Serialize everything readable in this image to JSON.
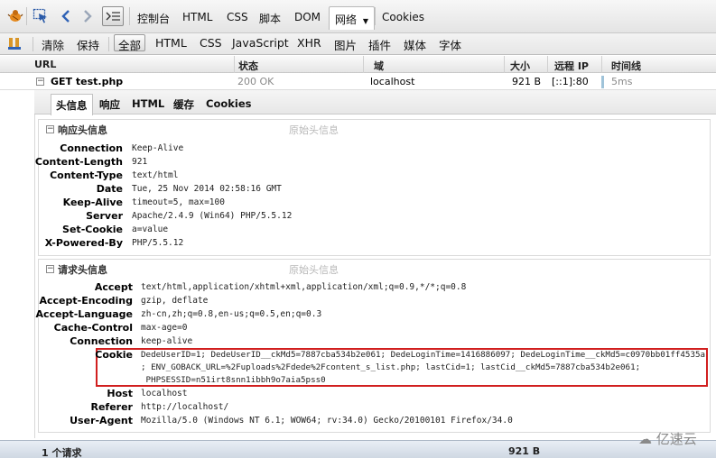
{
  "toolbar": {
    "tabs": [
      "控制台",
      "HTML",
      "CSS",
      "脚本",
      "DOM",
      "网络",
      "Cookies"
    ],
    "active_tab": "网络",
    "icons": [
      "firebug-icon",
      "inspect-icon",
      "back-icon",
      "forward-icon",
      "console-toggle-icon"
    ]
  },
  "filter": {
    "clear": "清除",
    "persist": "保持",
    "items": [
      "全部",
      "HTML",
      "CSS",
      "JavaScript",
      "XHR",
      "图片",
      "插件",
      "媒体",
      "字体"
    ],
    "active": "全部"
  },
  "columns": [
    "URL",
    "状态",
    "域",
    "大小",
    "远程 IP",
    "时间线"
  ],
  "request": {
    "url": "GET test.php",
    "status": "200 OK",
    "domain": "localhost",
    "size": "921 B",
    "remote_ip": "[::1]:80",
    "time": "5ms"
  },
  "subtabs": [
    "头信息",
    "响应",
    "HTML",
    "缓存",
    "Cookies"
  ],
  "response_headers": {
    "title": "响应头信息",
    "raw": "原始头信息",
    "rows": [
      {
        "name": "Connection",
        "value": "Keep-Alive"
      },
      {
        "name": "Content-Length",
        "value": "921"
      },
      {
        "name": "Content-Type",
        "value": "text/html"
      },
      {
        "name": "Date",
        "value": "Tue, 25 Nov 2014 02:58:16 GMT"
      },
      {
        "name": "Keep-Alive",
        "value": "timeout=5, max=100"
      },
      {
        "name": "Server",
        "value": "Apache/2.4.9 (Win64) PHP/5.5.12"
      },
      {
        "name": "Set-Cookie",
        "value": "a=value"
      },
      {
        "name": "X-Powered-By",
        "value": "PHP/5.5.12"
      }
    ]
  },
  "request_headers": {
    "title": "请求头信息",
    "raw": "原始头信息",
    "rows": [
      {
        "name": "Accept",
        "value": "text/html,application/xhtml+xml,application/xml;q=0.9,*/*;q=0.8"
      },
      {
        "name": "Accept-Encoding",
        "value": "gzip, deflate"
      },
      {
        "name": "Accept-Language",
        "value": "zh-cn,zh;q=0.8,en-us;q=0.5,en;q=0.3"
      },
      {
        "name": "Cache-Control",
        "value": "max-age=0"
      },
      {
        "name": "Connection",
        "value": "keep-alive"
      }
    ],
    "cookie": {
      "name": "Cookie",
      "lines": [
        "DedeUserID=1; DedeUserID__ckMd5=7887cba534b2e061; DedeLoginTime=1416886097; DedeLoginTime__ckMd5=c0970bb01ff4535a",
        "; ENV_GOBACK_URL=%2Fuploads%2Fdede%2Fcontent_s_list.php; lastCid=1; lastCid__ckMd5=7887cba534b2e061;",
        " PHPSESSID=n51irt8snn1ibbh9o7aia5pss0"
      ]
    },
    "rows_after": [
      {
        "name": "Host",
        "value": "localhost"
      },
      {
        "name": "Referer",
        "value": "http://localhost/"
      },
      {
        "name": "User-Agent",
        "value": "Mozilla/5.0 (Windows NT 6.1; WOW64; rv:34.0) Gecko/20100101 Firefox/34.0"
      }
    ]
  },
  "status": {
    "count": "1 个请求",
    "total": "921 B"
  },
  "watermark": "亿速云"
}
